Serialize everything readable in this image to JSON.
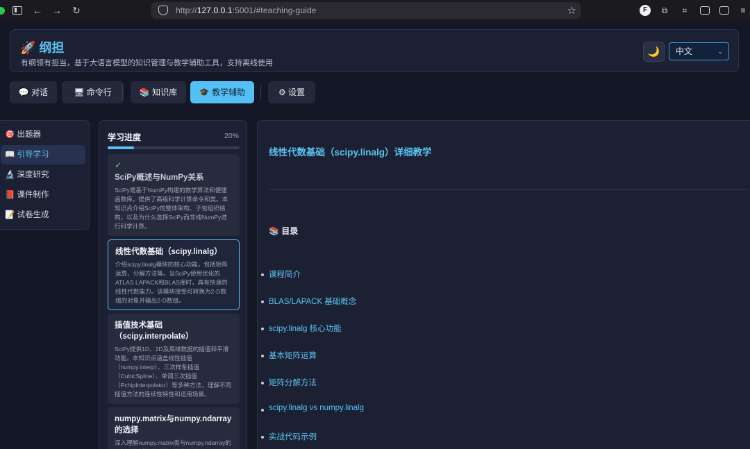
{
  "browser": {
    "url_prefix": "http://",
    "url_host": "127.0.0.1",
    "url_rest": ":5001/#teaching-guide"
  },
  "header": {
    "title": "🚀 纲担",
    "subtitle": "有纲领有担当，基于大语言模型的知识管理与教学辅助工具，支持离线使用",
    "theme_icon": "🌙",
    "language": "中文"
  },
  "tabs": [
    {
      "label": "💬 对话"
    },
    {
      "label": "🖥 命令行"
    },
    {
      "label": "📚 知识库"
    },
    {
      "label": "🎓 教学辅助"
    },
    {
      "label": "⚙ 设置"
    }
  ],
  "sidebar": {
    "items": [
      {
        "label": "🎯 出题器"
      },
      {
        "label": "📖 引导学习"
      },
      {
        "label": "🔬 深度研究"
      },
      {
        "label": "📕 课件制作"
      },
      {
        "label": "📝 试卷生成"
      }
    ]
  },
  "progress": {
    "title": "学习进度",
    "percent_label": "20%",
    "fraction": 0.2,
    "cards": [
      {
        "check": "✓",
        "title": "SciPy概述与NumPy关系",
        "desc": "SciPy是基于NumPy构建的数学算法和便捷函数库，提供了高级科学计算命令和类。本知识点介绍SciPy的整体架构、子包组织结构，以及为什么选择SciPy而非纯NumPy进行科学计算。"
      },
      {
        "title": "线性代数基础（scipy.linalg）",
        "desc": "介绍scipy.linalg模块的核心功能，包括矩阵运算、分解方法等。当SciPy使用优化的ATLAS LAPACK和BLAS库时，具有快速的线性代数能力。该模块接受可转换为2-D数组的对象并输出2-D数组。"
      },
      {
        "title": "插值技术基础（scipy.interpolate）",
        "desc": "SciPy提供1D、2D及高维数据的插值和平滑功能。本知识点涵盖线性插值（numpy.interp）、三次样条插值（CubicSpline）、单调三次插值（PchipInterpolator）等多种方法，理解不同插值方法的连续性特性和适用场景。"
      },
      {
        "title": "numpy.matrix与numpy.ndarray的选择",
        "desc": "深入理解numpy.matrix类与numpy.ndarray的区别，包括矩阵乘法运算符等差异"
      }
    ]
  },
  "content": {
    "title": "线性代数基础（scipy.linalg）详细教学",
    "toc_title": "📚 目录",
    "toc": [
      {
        "label": "课程简介"
      },
      {
        "label": "BLAS/LAPACK 基础概念"
      },
      {
        "label": "scipy.linalg 核心功能"
      },
      {
        "label": "基本矩阵运算"
      },
      {
        "label": "矩阵分解方法"
      },
      {
        "label": "scipy.linalg vs numpy.linalg"
      },
      {
        "label": "实战代码示例"
      }
    ]
  }
}
